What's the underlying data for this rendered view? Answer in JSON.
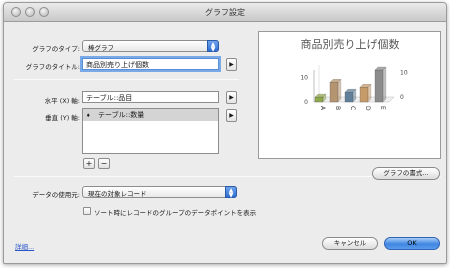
{
  "window": {
    "title": "グラフ設定"
  },
  "form": {
    "chart_type_label": "グラフのタイプ:",
    "chart_type_value": "棒グラフ",
    "chart_title_label": "グラフのタイトル:",
    "chart_title_value": "商品別売り上げ個数",
    "x_axis_label": "水平 (X) 軸:",
    "x_axis_value": "テーブル::品目",
    "y_axis_label": "垂直 (Y) 軸:",
    "y_axis_rows": [
      {
        "marker": "♦",
        "value": "テーブル::数量"
      }
    ],
    "add_label": "+",
    "remove_label": "−",
    "data_source_label": "データの使用元:",
    "data_source_value": "現在の対象レコード",
    "sort_checkbox_label": "ソート時にレコードのグループのデータポイントを表示",
    "sort_checkbox_checked": false
  },
  "preview": {
    "format_button_label": "グラフの書式..."
  },
  "chart_data": {
    "type": "bar",
    "title": "商品別売り上げ個数",
    "categories": [
      "A",
      "B",
      "C",
      "D",
      "E"
    ],
    "values": [
      2,
      8,
      4,
      6,
      13
    ],
    "series": [
      {
        "values": [
          2,
          8,
          4,
          6,
          13
        ]
      }
    ],
    "colors": [
      "#8fa84a",
      "#b59470",
      "#5f7f9a",
      "#c79a6a",
      "#8c8c8c"
    ],
    "left_ticks": [
      "10",
      "0"
    ],
    "right_ticks": [
      "10",
      "0"
    ],
    "ylim": [
      0,
      13
    ],
    "xlabel": "",
    "ylabel": "",
    "style": "3d"
  },
  "footer": {
    "details_link": "詳細...",
    "cancel_label": "キャンセル",
    "ok_label": "OK"
  },
  "icons": {
    "popup_arrows": "▲▼",
    "expand": "▶"
  }
}
